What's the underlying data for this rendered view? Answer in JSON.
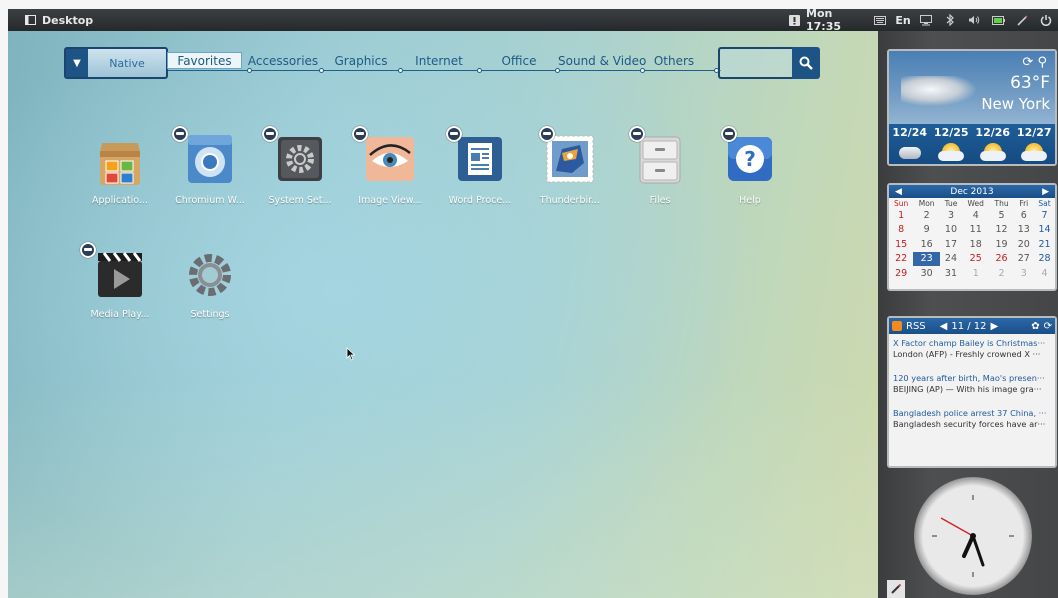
{
  "topbar": {
    "title": "Desktop",
    "clock": "Mon 17:35",
    "language": "En",
    "icons": [
      "notification-icon",
      "keyboard-icon",
      "display-icon",
      "bluetooth-icon",
      "volume-icon",
      "battery-icon",
      "pen-icon",
      "power-icon"
    ]
  },
  "categories": {
    "dropdown_label": "Native",
    "tabs": [
      "Favorites",
      "Accessories",
      "Graphics",
      "Internet",
      "Office",
      "Sound & Video",
      "Others"
    ],
    "active_tab": "Favorites",
    "search_placeholder": ""
  },
  "apps": [
    {
      "label": "Applicatio...",
      "icon": "app-center-icon",
      "removable": false
    },
    {
      "label": "Chromium W...",
      "icon": "chromium-icon",
      "removable": true
    },
    {
      "label": "System Set...",
      "icon": "system-settings-icon",
      "removable": true
    },
    {
      "label": "Image View...",
      "icon": "image-viewer-icon",
      "removable": true
    },
    {
      "label": "Word Proce...",
      "icon": "word-processor-icon",
      "removable": true
    },
    {
      "label": "Thunderbir...",
      "icon": "thunderbird-icon",
      "removable": true
    },
    {
      "label": "Files",
      "icon": "files-icon",
      "removable": true
    },
    {
      "label": "Help",
      "icon": "help-icon",
      "removable": true
    },
    {
      "label": "Media Play...",
      "icon": "media-player-icon",
      "removable": true
    },
    {
      "label": "Settings",
      "icon": "settings-gear-icon",
      "removable": false
    }
  ],
  "weather": {
    "temperature": "63°F",
    "city": "New York",
    "days": [
      {
        "date": "12/24",
        "icon": "cloud-icon"
      },
      {
        "date": "12/25",
        "icon": "partly-sunny-icon"
      },
      {
        "date": "12/26",
        "icon": "partly-sunny-icon"
      },
      {
        "date": "12/27",
        "icon": "partly-sunny-icon"
      }
    ]
  },
  "calendar": {
    "month": "Dec 2013",
    "weekdays": [
      "Sun",
      "Mon",
      "Tue",
      "Wed",
      "Thu",
      "Fri",
      "Sat"
    ],
    "weeks": [
      [
        "1",
        "2",
        "3",
        "4",
        "5",
        "6",
        "7"
      ],
      [
        "8",
        "9",
        "10",
        "11",
        "12",
        "13",
        "14"
      ],
      [
        "15",
        "16",
        "17",
        "18",
        "19",
        "20",
        "21"
      ],
      [
        "22",
        "23",
        "24",
        "25",
        "26",
        "27",
        "28"
      ],
      [
        "29",
        "30",
        "31",
        "1",
        "2",
        "3",
        "4"
      ]
    ],
    "today": "23",
    "holidays": [
      "25",
      "26"
    ]
  },
  "rss": {
    "title": "RSS",
    "pager": "11 / 12",
    "items": [
      {
        "title": "X Factor champ Bailey is Christmas···",
        "desc": "London (AFP) - Freshly crowned X ···"
      },
      {
        "title": "120 years after birth, Mao's presen···",
        "desc": "BEIJING (AP) — With his image gra···"
      },
      {
        "title": "Bangladesh police arrest 37 China, ···",
        "desc": "Bangladesh security forces have ar···"
      }
    ]
  },
  "clock_widget": {
    "time": "17:35"
  }
}
